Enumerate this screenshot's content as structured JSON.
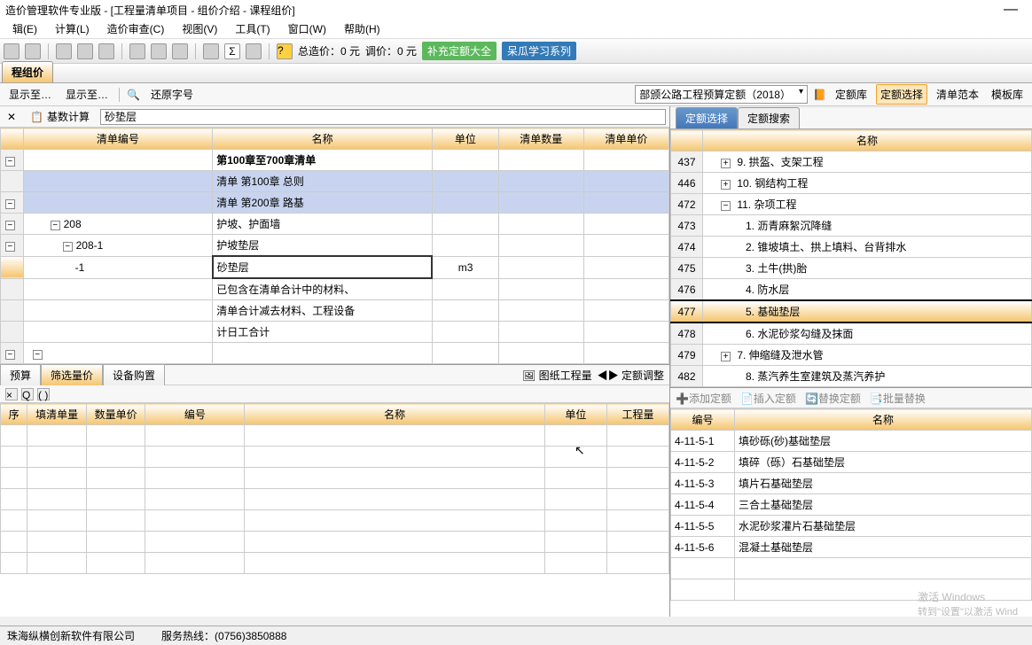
{
  "title": "造价管理软件专业版 - [工程量清单项目 - 组价介绍 - 课程组价]",
  "menu": [
    "辑(E)",
    "计算(L)",
    "造价审查(C)",
    "视图(V)",
    "工具(T)",
    "窗口(W)",
    "帮助(H)"
  ],
  "toolbar": {
    "total_label": "总造价：0 元",
    "adj_label": "调价：0 元",
    "badge1": "补充定额大全",
    "badge2": "呆瓜学习系列"
  },
  "maintab": "程组价",
  "subbar": {
    "left": [
      "显示至…",
      "显示至…"
    ],
    "restore": "还原字号",
    "dropdown": "部颁公路工程预算定额（2018）",
    "links": [
      "定额库",
      "定额选择",
      "清单范本",
      "模板库"
    ]
  },
  "row2": {
    "calc": "基数计算",
    "inp": "砂垫层"
  },
  "lcols": [
    "清单编号",
    "名称",
    "单位",
    "清单数量",
    "清单单价"
  ],
  "lrows": [
    {
      "exp": "-",
      "num": "",
      "name": "第100章至700章清单",
      "unit": "",
      "qty": "",
      "price": "",
      "bold": true
    },
    {
      "exp": "",
      "num": "",
      "name": "清单  第100章    总则",
      "unit": "",
      "qty": "",
      "price": "",
      "sel": true
    },
    {
      "exp": "-",
      "num": "",
      "name": "清单  第200章    路基",
      "unit": "",
      "qty": "",
      "price": "",
      "sel": true
    },
    {
      "exp": "-",
      "num": "208",
      "name": "护坡、护面墙",
      "unit": "",
      "qty": "",
      "price": ""
    },
    {
      "exp": "-",
      "num": "208-1",
      "name": "护坡垫层",
      "unit": "",
      "qty": "",
      "price": ""
    },
    {
      "exp": "",
      "num": "-1",
      "name": "砂垫层",
      "unit": "m3",
      "qty": "",
      "price": "",
      "foc": true,
      "mark": true
    },
    {
      "exp": "",
      "num": "",
      "name": "已包含在清单合计中的材料、",
      "unit": "",
      "qty": "",
      "price": ""
    },
    {
      "exp": "",
      "num": "",
      "name": "清单合计减去材料、工程设备",
      "unit": "",
      "qty": "",
      "price": ""
    },
    {
      "exp": "",
      "num": "",
      "name": "计日工合计",
      "unit": "",
      "qty": "",
      "price": ""
    },
    {
      "exp": "-",
      "num": "",
      "name": "",
      "unit": "",
      "qty": "",
      "price": ""
    }
  ],
  "btabs": [
    "预算",
    "筛选量价",
    "设备购置"
  ],
  "bbtn": [
    "图纸工程量",
    "定额调整"
  ],
  "smallbar": [
    "×",
    "Q",
    "( )"
  ],
  "bcols": [
    "序",
    "填清单量",
    "数量单价",
    "编号",
    "名称",
    "单位",
    "工程量"
  ],
  "rtabs": [
    "定额选择",
    "定额搜索"
  ],
  "rcol": "名称",
  "rrows": [
    {
      "n": "437",
      "exp": "+",
      "t": "9. 拱盔、支架工程"
    },
    {
      "n": "446",
      "exp": "+",
      "t": "10. 钢结构工程"
    },
    {
      "n": "472",
      "exp": "-",
      "t": "11. 杂项工程"
    },
    {
      "n": "473",
      "exp": "",
      "t": "1. 沥青麻絮沉降缝"
    },
    {
      "n": "474",
      "exp": "",
      "t": "2. 锥坡填土、拱上填料、台背排水"
    },
    {
      "n": "475",
      "exp": "",
      "t": "3. 土牛(拱)胎"
    },
    {
      "n": "476",
      "exp": "",
      "t": "4. 防水层"
    },
    {
      "n": "477",
      "exp": "",
      "t": "5. 基础垫层",
      "hl": true
    },
    {
      "n": "478",
      "exp": "",
      "t": "6. 水泥砂浆勾缝及抹面"
    },
    {
      "n": "479",
      "exp": "+",
      "t": "7. 伸缩缝及泄水管"
    },
    {
      "n": "482",
      "exp": "",
      "t": "8. 蒸汽养生室建筑及蒸汽养护"
    }
  ],
  "rtool": [
    "添加定额",
    "插入定额",
    "替换定额",
    "批量替换"
  ],
  "rbcols": [
    "编号",
    "名称"
  ],
  "rbrows": [
    {
      "id": "4-11-5-1",
      "nm": "填砂砾(砂)基础垫层"
    },
    {
      "id": "4-11-5-2",
      "nm": "填碎（砾）石基础垫层"
    },
    {
      "id": "4-11-5-3",
      "nm": "填片石基础垫层"
    },
    {
      "id": "4-11-5-4",
      "nm": "三合土基础垫层"
    },
    {
      "id": "4-11-5-5",
      "nm": "水泥砂浆灌片石基础垫层"
    },
    {
      "id": "4-11-5-6",
      "nm": "混凝土基础垫层"
    }
  ],
  "status": {
    "company": "珠海纵横创新软件有限公司",
    "hotline_l": "服务热线：",
    "hotline": "(0756)3850888"
  },
  "watermark": {
    "l1": "激活 Windows",
    "l2": "转到\"设置\"以激活 Wind"
  }
}
